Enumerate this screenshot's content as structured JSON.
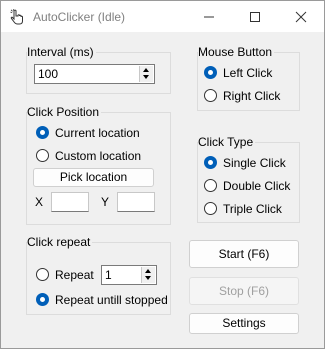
{
  "window": {
    "title": "AutoClicker (Idle)"
  },
  "interval": {
    "label": "Interval (ms)",
    "value": "100"
  },
  "mouse_button": {
    "label": "Mouse Button",
    "options": [
      "Left Click",
      "Right Click"
    ],
    "selected": "Left Click"
  },
  "click_position": {
    "label": "Click Position",
    "current": "Current location",
    "custom": "Custom location",
    "selected": "Current location",
    "pick_label": "Pick location",
    "x_label": "X",
    "y_label": "Y",
    "x_value": "",
    "y_value": ""
  },
  "click_type": {
    "label": "Click Type",
    "options": [
      "Single Click",
      "Double Click",
      "Triple Click"
    ],
    "selected": "Single Click"
  },
  "click_repeat": {
    "label": "Click repeat",
    "repeat_label": "Repeat",
    "repeat_value": "1",
    "until_stopped_label": "Repeat untill stopped",
    "selected": "Repeat untill stopped"
  },
  "buttons": {
    "start": "Start (F6)",
    "stop": "Stop (F6)",
    "settings": "Settings"
  }
}
